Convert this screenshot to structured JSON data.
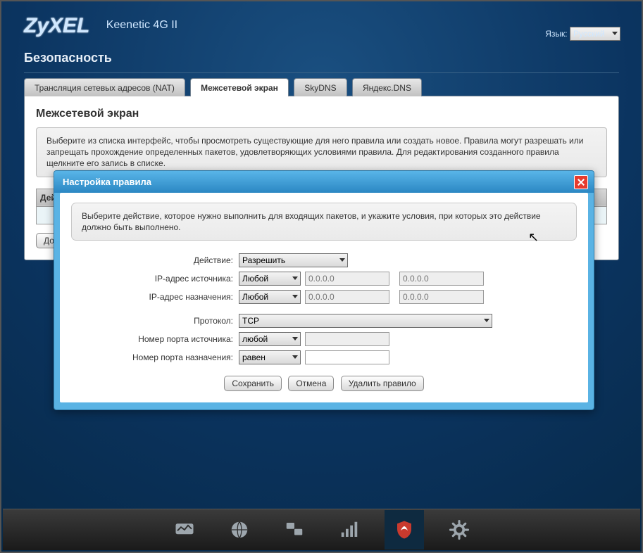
{
  "brand": "ZyXEL",
  "product": "Keenetic 4G II",
  "language": {
    "label": "Язык:",
    "value": "Русский"
  },
  "page_title": "Безопасность",
  "tabs": [
    {
      "label": "Трансляция сетевых адресов (NAT)"
    },
    {
      "label": "Межсетевой экран"
    },
    {
      "label": "SkyDNS"
    },
    {
      "label": "Яндекс.DNS"
    }
  ],
  "section_title": "Межсетевой экран",
  "section_info": "Выберите из списка интерфейс, чтобы просмотреть существующие для него правила или создать новое. Правила могут разрешать или запрещать прохождение определенных пакетов, удовлетворяющих условиями правила. Для редактирования созданного правила щелкните его запись в списке.",
  "table": {
    "col1": "Дей"
  },
  "add_button": "Доб",
  "dialog": {
    "title": "Настройка правила",
    "info": "Выберите действие, которое нужно выполнить для входящих пакетов, и укажите условия, при которых это действие должно быть выполнено.",
    "labels": {
      "action": "Действие:",
      "src_ip": "IP-адрес источника:",
      "dst_ip": "IP-адрес назначения:",
      "protocol": "Протокол:",
      "src_port": "Номер порта источника:",
      "dst_port": "Номер порта назначения:"
    },
    "values": {
      "action": "Разрешить",
      "src_ip_mode": "Любой",
      "src_ip_ph1": "0.0.0.0",
      "src_ip_ph2": "0.0.0.0",
      "dst_ip_mode": "Любой",
      "dst_ip_ph1": "0.0.0.0",
      "dst_ip_ph2": "0.0.0.0",
      "protocol": "TCP",
      "src_port_mode": "любой",
      "src_port_val": "",
      "dst_port_mode": "равен",
      "dst_port_val": ""
    },
    "buttons": {
      "save": "Сохранить",
      "cancel": "Отмена",
      "delete": "Удалить правило"
    }
  }
}
